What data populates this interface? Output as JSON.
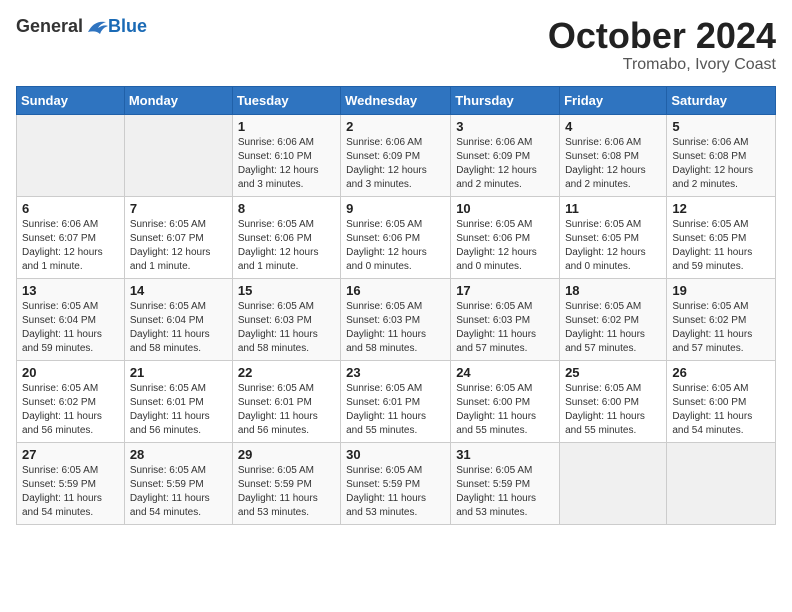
{
  "logo": {
    "general": "General",
    "blue": "Blue"
  },
  "title": {
    "month": "October 2024",
    "location": "Tromabo, Ivory Coast"
  },
  "weekdays": [
    "Sunday",
    "Monday",
    "Tuesday",
    "Wednesday",
    "Thursday",
    "Friday",
    "Saturday"
  ],
  "weeks": [
    [
      {
        "day": "",
        "info": ""
      },
      {
        "day": "",
        "info": ""
      },
      {
        "day": "1",
        "info": "Sunrise: 6:06 AM\nSunset: 6:10 PM\nDaylight: 12 hours\nand 3 minutes."
      },
      {
        "day": "2",
        "info": "Sunrise: 6:06 AM\nSunset: 6:09 PM\nDaylight: 12 hours\nand 3 minutes."
      },
      {
        "day": "3",
        "info": "Sunrise: 6:06 AM\nSunset: 6:09 PM\nDaylight: 12 hours\nand 2 minutes."
      },
      {
        "day": "4",
        "info": "Sunrise: 6:06 AM\nSunset: 6:08 PM\nDaylight: 12 hours\nand 2 minutes."
      },
      {
        "day": "5",
        "info": "Sunrise: 6:06 AM\nSunset: 6:08 PM\nDaylight: 12 hours\nand 2 minutes."
      }
    ],
    [
      {
        "day": "6",
        "info": "Sunrise: 6:06 AM\nSunset: 6:07 PM\nDaylight: 12 hours\nand 1 minute."
      },
      {
        "day": "7",
        "info": "Sunrise: 6:05 AM\nSunset: 6:07 PM\nDaylight: 12 hours\nand 1 minute."
      },
      {
        "day": "8",
        "info": "Sunrise: 6:05 AM\nSunset: 6:06 PM\nDaylight: 12 hours\nand 1 minute."
      },
      {
        "day": "9",
        "info": "Sunrise: 6:05 AM\nSunset: 6:06 PM\nDaylight: 12 hours\nand 0 minutes."
      },
      {
        "day": "10",
        "info": "Sunrise: 6:05 AM\nSunset: 6:06 PM\nDaylight: 12 hours\nand 0 minutes."
      },
      {
        "day": "11",
        "info": "Sunrise: 6:05 AM\nSunset: 6:05 PM\nDaylight: 12 hours\nand 0 minutes."
      },
      {
        "day": "12",
        "info": "Sunrise: 6:05 AM\nSunset: 6:05 PM\nDaylight: 11 hours\nand 59 minutes."
      }
    ],
    [
      {
        "day": "13",
        "info": "Sunrise: 6:05 AM\nSunset: 6:04 PM\nDaylight: 11 hours\nand 59 minutes."
      },
      {
        "day": "14",
        "info": "Sunrise: 6:05 AM\nSunset: 6:04 PM\nDaylight: 11 hours\nand 58 minutes."
      },
      {
        "day": "15",
        "info": "Sunrise: 6:05 AM\nSunset: 6:03 PM\nDaylight: 11 hours\nand 58 minutes."
      },
      {
        "day": "16",
        "info": "Sunrise: 6:05 AM\nSunset: 6:03 PM\nDaylight: 11 hours\nand 58 minutes."
      },
      {
        "day": "17",
        "info": "Sunrise: 6:05 AM\nSunset: 6:03 PM\nDaylight: 11 hours\nand 57 minutes."
      },
      {
        "day": "18",
        "info": "Sunrise: 6:05 AM\nSunset: 6:02 PM\nDaylight: 11 hours\nand 57 minutes."
      },
      {
        "day": "19",
        "info": "Sunrise: 6:05 AM\nSunset: 6:02 PM\nDaylight: 11 hours\nand 57 minutes."
      }
    ],
    [
      {
        "day": "20",
        "info": "Sunrise: 6:05 AM\nSunset: 6:02 PM\nDaylight: 11 hours\nand 56 minutes."
      },
      {
        "day": "21",
        "info": "Sunrise: 6:05 AM\nSunset: 6:01 PM\nDaylight: 11 hours\nand 56 minutes."
      },
      {
        "day": "22",
        "info": "Sunrise: 6:05 AM\nSunset: 6:01 PM\nDaylight: 11 hours\nand 56 minutes."
      },
      {
        "day": "23",
        "info": "Sunrise: 6:05 AM\nSunset: 6:01 PM\nDaylight: 11 hours\nand 55 minutes."
      },
      {
        "day": "24",
        "info": "Sunrise: 6:05 AM\nSunset: 6:00 PM\nDaylight: 11 hours\nand 55 minutes."
      },
      {
        "day": "25",
        "info": "Sunrise: 6:05 AM\nSunset: 6:00 PM\nDaylight: 11 hours\nand 55 minutes."
      },
      {
        "day": "26",
        "info": "Sunrise: 6:05 AM\nSunset: 6:00 PM\nDaylight: 11 hours\nand 54 minutes."
      }
    ],
    [
      {
        "day": "27",
        "info": "Sunrise: 6:05 AM\nSunset: 5:59 PM\nDaylight: 11 hours\nand 54 minutes."
      },
      {
        "day": "28",
        "info": "Sunrise: 6:05 AM\nSunset: 5:59 PM\nDaylight: 11 hours\nand 54 minutes."
      },
      {
        "day": "29",
        "info": "Sunrise: 6:05 AM\nSunset: 5:59 PM\nDaylight: 11 hours\nand 53 minutes."
      },
      {
        "day": "30",
        "info": "Sunrise: 6:05 AM\nSunset: 5:59 PM\nDaylight: 11 hours\nand 53 minutes."
      },
      {
        "day": "31",
        "info": "Sunrise: 6:05 AM\nSunset: 5:59 PM\nDaylight: 11 hours\nand 53 minutes."
      },
      {
        "day": "",
        "info": ""
      },
      {
        "day": "",
        "info": ""
      }
    ]
  ]
}
